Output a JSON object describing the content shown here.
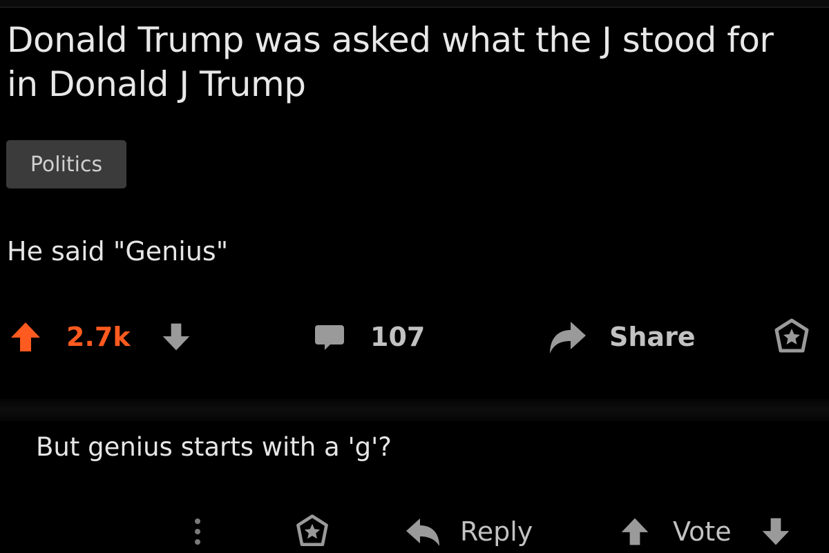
{
  "post": {
    "title": "Donald Trump was asked what the J stood for in Donald J Trump",
    "flair": "Politics",
    "body": "He said \"Genius\""
  },
  "actions": {
    "score": "2.7k",
    "comment_count": "107",
    "share_label": "Share"
  },
  "comment": {
    "text": "But genius starts with a 'g'?",
    "reply_label": "Reply",
    "vote_label": "Vote"
  },
  "colors": {
    "background": "#000000",
    "upvote_accent": "#ff5a1f",
    "icon_gray": "#9a9a9a",
    "flair_bg": "#3b3b3b"
  },
  "icons": [
    "upvote-arrow-icon",
    "downvote-arrow-icon",
    "comment-bubble-icon",
    "share-arrow-icon",
    "award-icon",
    "more-dots-icon",
    "reply-arrow-icon"
  ]
}
